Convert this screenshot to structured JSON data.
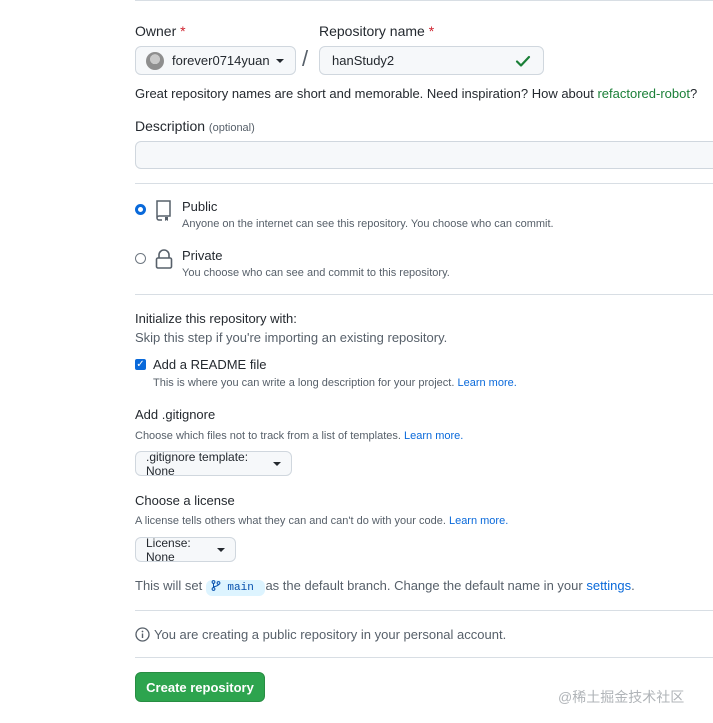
{
  "owner": {
    "label": "Owner",
    "required_mark": "*",
    "value": "forever0714yuan"
  },
  "repo": {
    "label": "Repository name",
    "required_mark": "*",
    "value": "hanStudy2"
  },
  "separator": "/",
  "hint": {
    "text": "Great repository names are short and memorable. Need inspiration? How about ",
    "suggestion": "refactored-robot",
    "suffix": "?"
  },
  "description": {
    "label": "Description",
    "optional": "(optional)",
    "value": ""
  },
  "visibility": {
    "public": {
      "title": "Public",
      "desc": "Anyone on the internet can see this repository. You choose who can commit."
    },
    "private": {
      "title": "Private",
      "desc": "You choose who can see and commit to this repository."
    }
  },
  "init": {
    "title": "Initialize this repository with:",
    "subtitle": "Skip this step if you're importing an existing repository.",
    "readme_label": "Add a README file",
    "readme_desc": "This is where you can write a long description for your project.",
    "readme_link": "Learn more."
  },
  "gitignore": {
    "title": "Add .gitignore",
    "desc": "Choose which files not to track from a list of templates.",
    "link": "Learn more.",
    "button": ".gitignore template: None"
  },
  "license": {
    "title": "Choose a license",
    "desc": "A license tells others what they can and can't do with your code.",
    "link": "Learn more.",
    "button": "License: None"
  },
  "branch": {
    "prefix": "This will set",
    "name": "main",
    "middle": "as the default branch. Change the default name in your",
    "settings_link": "settings",
    "suffix": "."
  },
  "notice": "You are creating a public repository in your personal account.",
  "create_button": "Create repository",
  "watermark": "@稀土掘金技术社区",
  "colors": {
    "accent": "#0969da",
    "success": "#2da44e",
    "checkmark": "#1a7f37"
  }
}
